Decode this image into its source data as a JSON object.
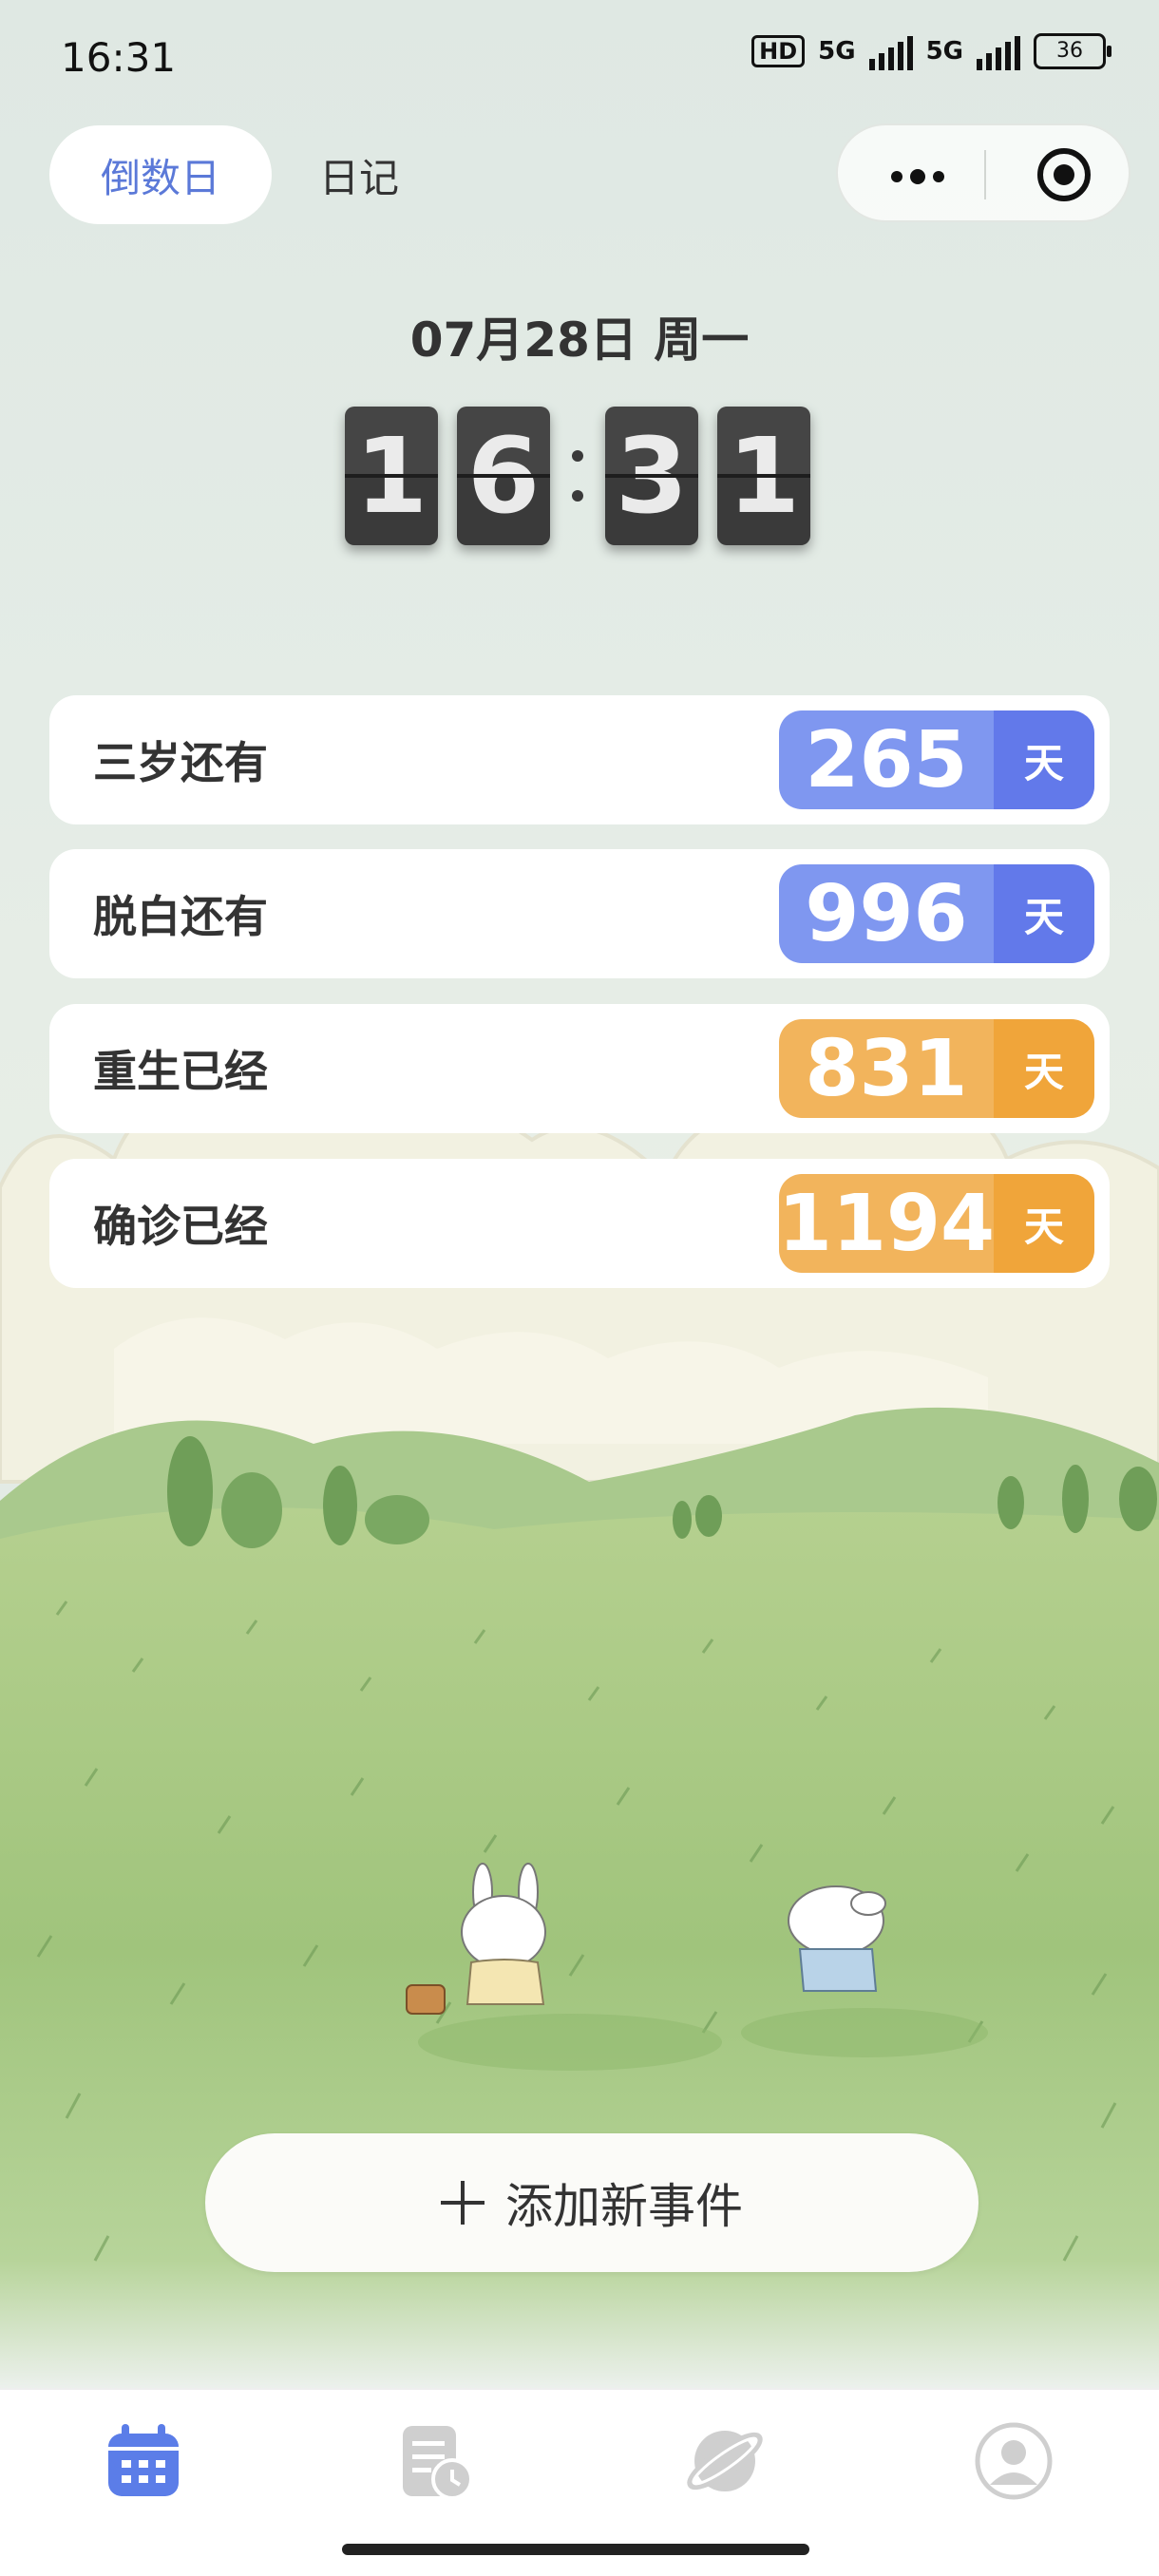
{
  "status": {
    "time": "16:31",
    "hd": "HD",
    "net1": "5G",
    "net2": "5G",
    "battery": "36"
  },
  "tabs": [
    {
      "label": "倒数日",
      "active": true
    },
    {
      "label": "日记",
      "active": false
    }
  ],
  "header": {
    "date": "07月28日 周一"
  },
  "clock": {
    "digits": [
      "1",
      "6",
      "3",
      "1"
    ]
  },
  "events": [
    {
      "label": "三岁还有",
      "value": "265",
      "unit": "天",
      "color": "#7f97f0",
      "unit_color": "#6279ea"
    },
    {
      "label": "脱白还有",
      "value": "996",
      "unit": "天",
      "color": "#7f97f0",
      "unit_color": "#6279ea"
    },
    {
      "label": "重生已经",
      "value": "831",
      "unit": "天",
      "color": "#f2b45c",
      "unit_color": "#f0a53a"
    },
    {
      "label": "确诊已经",
      "value": "1194",
      "unit": "天",
      "color": "#f2b45c",
      "unit_color": "#f0a53a"
    }
  ],
  "add_button": {
    "label": "添加新事件"
  },
  "nav": [
    {
      "icon": "calendar-icon",
      "active": true
    },
    {
      "icon": "diary-clock-icon",
      "active": false
    },
    {
      "icon": "planet-icon",
      "active": false
    },
    {
      "icon": "profile-icon",
      "active": false
    }
  ],
  "colors": {
    "accent": "#5b79d8",
    "orange": "#f2b45c",
    "nav_active": "#5b7de8",
    "nav_inactive": "#cfcfcf"
  }
}
